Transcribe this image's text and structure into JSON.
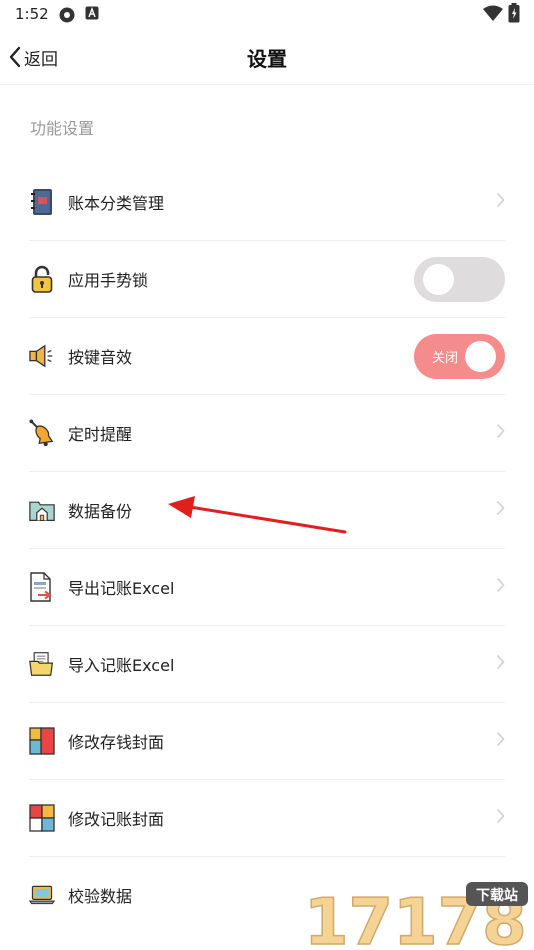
{
  "status_bar": {
    "time": "1:52"
  },
  "nav": {
    "back_label": "返回",
    "title": "设置"
  },
  "section": {
    "title": "功能设置"
  },
  "items": [
    {
      "label": "账本分类管理",
      "icon": "notebook-icon",
      "control": "chevron"
    },
    {
      "label": "应用手势锁",
      "icon": "padlock-icon",
      "control": "toggle",
      "toggle_state": "off"
    },
    {
      "label": "按键音效",
      "icon": "speaker-icon",
      "control": "toggle",
      "toggle_state": "on",
      "toggle_text": "关闭"
    },
    {
      "label": "定时提醒",
      "icon": "bell-icon",
      "control": "chevron"
    },
    {
      "label": "数据备份",
      "icon": "folder-home-icon",
      "control": "chevron"
    },
    {
      "label": "导出记账Excel",
      "icon": "export-document-icon",
      "control": "chevron"
    },
    {
      "label": "导入记账Excel",
      "icon": "import-folder-icon",
      "control": "chevron"
    },
    {
      "label": "修改存钱封面",
      "icon": "cover-grid-icon",
      "control": "chevron"
    },
    {
      "label": "修改记账封面",
      "icon": "cover-grid-alt-icon",
      "control": "chevron"
    },
    {
      "label": "校验数据",
      "icon": "laptop-icon",
      "control": "chevron"
    }
  ],
  "watermark": {
    "text": "17178",
    "badge": "下载站"
  }
}
